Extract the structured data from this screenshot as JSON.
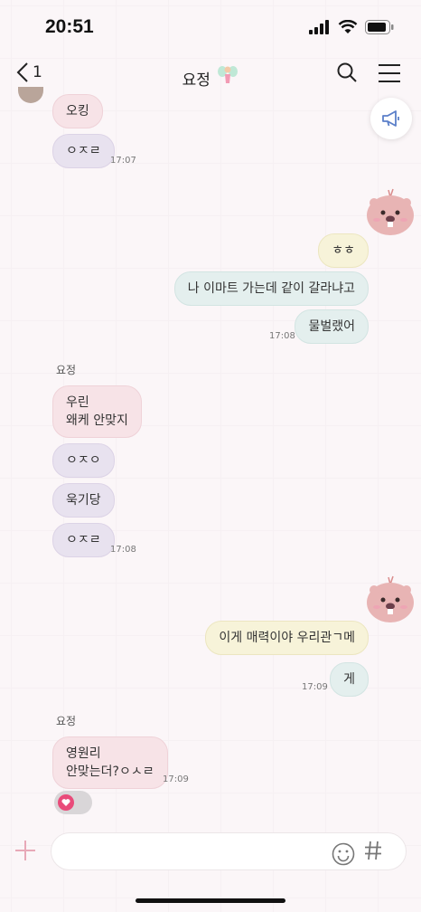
{
  "status_bar": {
    "time": "20:51"
  },
  "header": {
    "back_count": "1",
    "title": "요정"
  },
  "messages": [
    {
      "text": "오킹"
    },
    {
      "text": "ㅇㅈㄹ",
      "time": "17:07"
    },
    {
      "text": "ㅎㅎ"
    },
    {
      "text": "나 이마트 가는데 같이 갈라냐고"
    },
    {
      "text": "물벌랬어",
      "time": "17:08"
    },
    {
      "sender": "요정",
      "line1": "우린",
      "line2": "왜케 안맞지"
    },
    {
      "text": "ㅇㅈㅇ"
    },
    {
      "text": "욱기당"
    },
    {
      "text": "ㅇㅈㄹ",
      "time": "17:08"
    },
    {
      "text": "이게 매력이야 우리관ㄱ메"
    },
    {
      "text": "게",
      "time": "17:09"
    },
    {
      "sender": "요정",
      "line1": "영원리",
      "line2": "안맞는더?ㅇㅅㄹ",
      "time": "17:09"
    }
  ],
  "colors": {
    "purple_bubble": "#e8e2ef",
    "pink_bubble": "#f7e3e7",
    "yellow_bubble": "#f7f3d9",
    "teal_bubble": "#e4efee",
    "accent_pink": "#e8a9b8"
  },
  "icons": [
    "back-icon",
    "search-icon",
    "menu-icon",
    "megaphone-icon",
    "plus-icon",
    "emoji-icon",
    "hash-icon",
    "heart-icon",
    "beaver-avatar",
    "fairy-icon"
  ]
}
